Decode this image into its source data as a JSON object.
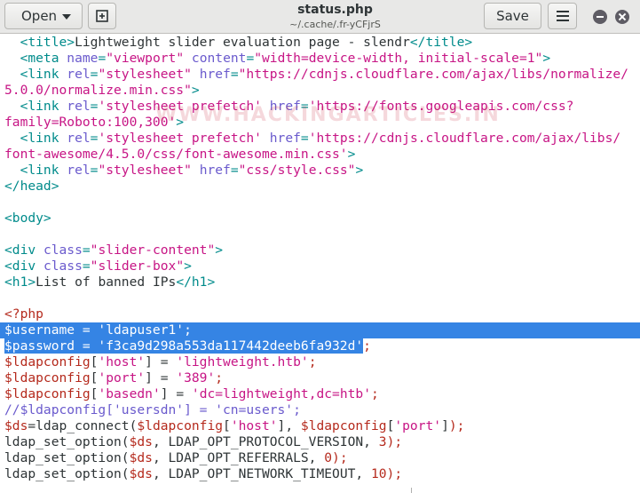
{
  "toolbar": {
    "open_label": "Open",
    "save_label": "Save",
    "title": "status.php",
    "subtitle": "~/.cache/.fr-yCFjrS"
  },
  "icons": [
    "new-document-icon",
    "chevron-down-icon",
    "hamburger-menu-icon",
    "minimize-icon",
    "close-icon"
  ],
  "colors": {
    "tag": "#008b8b",
    "attribute": "#6a5acd",
    "string": "#c71585",
    "variable": "#b52a1d",
    "selection": "#3584e4"
  },
  "watermark": "WWW.HACKINGARTICLES.IN",
  "code": {
    "lines": [
      [
        [
          "t",
          "  <title>"
        ],
        [
          "",
          "Lightweight slider evaluation page - slendr"
        ],
        [
          "t",
          "</title>"
        ]
      ],
      [
        [
          "t",
          "  <meta "
        ],
        [
          "a",
          "name"
        ],
        [
          "t",
          "="
        ],
        [
          "s",
          "\"viewport\""
        ],
        [
          "t",
          " "
        ],
        [
          "a",
          "content"
        ],
        [
          "t",
          "="
        ],
        [
          "s",
          "\"width=device-width, initial-scale=1\""
        ],
        [
          "t",
          ">"
        ]
      ],
      [
        [
          "t",
          "  <link "
        ],
        [
          "a",
          "rel"
        ],
        [
          "t",
          "="
        ],
        [
          "s",
          "\"stylesheet\""
        ],
        [
          "t",
          " "
        ],
        [
          "a",
          "href"
        ],
        [
          "t",
          "="
        ],
        [
          "s",
          "\"https://cdnjs.cloudflare.com/ajax/libs/normalize/"
        ]
      ],
      [
        [
          "s",
          "5.0.0/normalize.min.css\""
        ],
        [
          "t",
          ">"
        ]
      ],
      [
        [
          "t",
          "  <link "
        ],
        [
          "a",
          "rel"
        ],
        [
          "t",
          "="
        ],
        [
          "s",
          "'stylesheet prefetch'"
        ],
        [
          "t",
          " "
        ],
        [
          "a",
          "href"
        ],
        [
          "t",
          "="
        ],
        [
          "s",
          "'https://fonts.googleapis.com/css?"
        ]
      ],
      [
        [
          "s",
          "family=Roboto:100,300'"
        ],
        [
          "t",
          ">"
        ]
      ],
      [
        [
          "t",
          "  <link "
        ],
        [
          "a",
          "rel"
        ],
        [
          "t",
          "="
        ],
        [
          "s",
          "'stylesheet prefetch'"
        ],
        [
          "t",
          " "
        ],
        [
          "a",
          "href"
        ],
        [
          "t",
          "="
        ],
        [
          "s",
          "'https://cdnjs.cloudflare.com/ajax/libs/"
        ]
      ],
      [
        [
          "s",
          "font-awesome/4.5.0/css/font-awesome.min.css'"
        ],
        [
          "t",
          ">"
        ]
      ],
      [
        [
          "t",
          "  <link "
        ],
        [
          "a",
          "rel"
        ],
        [
          "t",
          "="
        ],
        [
          "s",
          "\"stylesheet\""
        ],
        [
          "t",
          " "
        ],
        [
          "a",
          "href"
        ],
        [
          "t",
          "="
        ],
        [
          "s",
          "\"css/style.css\""
        ],
        [
          "t",
          ">"
        ]
      ],
      [
        [
          "t",
          "</head>"
        ]
      ],
      [
        [
          "",
          ""
        ]
      ],
      [
        [
          "t",
          "<body>"
        ]
      ],
      [
        [
          "",
          ""
        ]
      ],
      [
        [
          "t",
          "<div "
        ],
        [
          "a",
          "class"
        ],
        [
          "t",
          "="
        ],
        [
          "s",
          "\"slider-content\""
        ],
        [
          "t",
          ">"
        ]
      ],
      [
        [
          "t",
          "<div "
        ],
        [
          "a",
          "class"
        ],
        [
          "t",
          "="
        ],
        [
          "s",
          "\"slider-box\""
        ],
        [
          "t",
          ">"
        ]
      ],
      [
        [
          "t",
          "<h1>"
        ],
        [
          "",
          "List of banned IPs"
        ],
        [
          "t",
          "</h1>"
        ]
      ],
      [
        [
          "",
          ""
        ]
      ],
      [
        [
          "v",
          "<?php"
        ]
      ],
      [
        [
          "sel",
          "$username = 'ldapuser1';"
        ]
      ],
      [
        [
          "sel",
          "$password = 'f3ca9d298a553da117442deeb6fa932d'"
        ],
        [
          "v",
          ";"
        ]
      ],
      [
        [
          "v",
          "$ldapconfig"
        ],
        [
          "",
          "["
        ],
        [
          "s",
          "'host'"
        ],
        [
          "",
          "] = "
        ],
        [
          "s",
          "'lightweight.htb'"
        ],
        [
          "v",
          ";"
        ]
      ],
      [
        [
          "v",
          "$ldapconfig"
        ],
        [
          "",
          "["
        ],
        [
          "s",
          "'port'"
        ],
        [
          "",
          "] = "
        ],
        [
          "s",
          "'389'"
        ],
        [
          "v",
          ";"
        ]
      ],
      [
        [
          "v",
          "$ldapconfig"
        ],
        [
          "",
          "["
        ],
        [
          "s",
          "'basedn'"
        ],
        [
          "",
          "] = "
        ],
        [
          "s",
          "'dc=lightweight,dc=htb'"
        ],
        [
          "v",
          ";"
        ]
      ],
      [
        [
          "a",
          "//$ldapconfig['usersdn'] = 'cn=users';"
        ]
      ],
      [
        [
          "v",
          "$ds"
        ],
        [
          "",
          "=ldap_connect("
        ],
        [
          "v",
          "$ldapconfig"
        ],
        [
          "",
          "["
        ],
        [
          "s",
          "'host'"
        ],
        [
          "",
          "], "
        ],
        [
          "v",
          "$ldapconfig"
        ],
        [
          "",
          "["
        ],
        [
          "s",
          "'port'"
        ],
        [
          "",
          "]"
        ],
        [
          "v",
          ");"
        ]
      ],
      [
        [
          "",
          "ldap_set_option("
        ],
        [
          "v",
          "$ds"
        ],
        [
          "",
          ", LDAP_OPT_PROTOCOL_VERSION, "
        ],
        [
          "v",
          "3"
        ],
        [
          "v",
          ");"
        ]
      ],
      [
        [
          "",
          "ldap_set_option("
        ],
        [
          "v",
          "$ds"
        ],
        [
          "",
          ", LDAP_OPT_REFERRALS, "
        ],
        [
          "v",
          "0"
        ],
        [
          "v",
          ");"
        ]
      ],
      [
        [
          "",
          "ldap_set_option("
        ],
        [
          "v",
          "$ds"
        ],
        [
          "",
          ", LDAP_OPT_NETWORK_TIMEOUT, "
        ],
        [
          "v",
          "10"
        ],
        [
          "v",
          ");"
        ]
      ]
    ]
  }
}
